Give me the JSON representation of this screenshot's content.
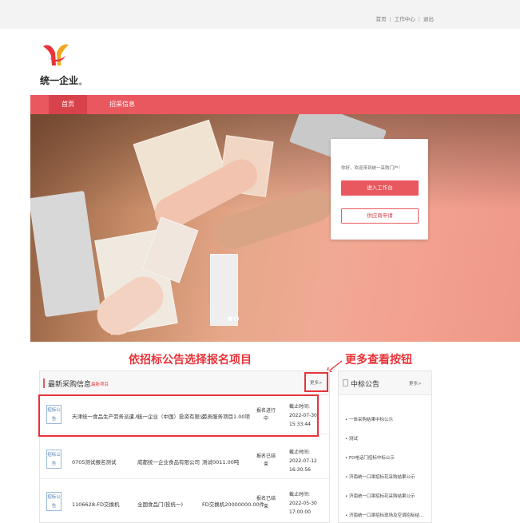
{
  "topbar": {
    "links": [
      "首页",
      "工作中心",
      "退出"
    ],
    "separator": "|"
  },
  "logo": {
    "text": "统一企业",
    "reg": "®"
  },
  "nav": {
    "items": [
      "首页",
      "招采信息"
    ]
  },
  "banner": {
    "login": {
      "welcome": "你好，欢迎来到统一采购门户！",
      "workbench_button": "进入工作台",
      "supplier_button": "供应商申请"
    }
  },
  "annotations": {
    "left": "依招标公告选择报名项目",
    "right": "更多查看按钮"
  },
  "main_panel": {
    "title": "最新采购信息",
    "subtitle": "最新项目",
    "more": "更多>",
    "rows": [
      {
        "badge": "招标公告",
        "name": "天津统一食品生产劳务派遣人...",
        "company": "统一企业（中国）投资有限公...",
        "code": "劳务服务项目1.00项",
        "status": "报名进行中",
        "deadline_label": "截止时间:",
        "deadline_date": "2022-07-30",
        "deadline_time": "15:33:44"
      },
      {
        "badge": "招标公告",
        "name": "0705测试报名测试",
        "company": "成都统一企业食品有限公司",
        "code": "测试0011.00吨",
        "status": "报名已结束",
        "deadline_label": "截止时间:",
        "deadline_date": "2022-07-12",
        "deadline_time": "16:30:56"
      },
      {
        "badge": "招标公告",
        "name": "1106628-FD交换机",
        "company": "全国食品门(投统一)",
        "code": "FD交换机20000000.00件",
        "status": "报名已结束",
        "deadline_label": "截止时间:",
        "deadline_date": "2022-05-30",
        "deadline_time": "17:00:00"
      }
    ]
  },
  "side_panel": {
    "title": "中标公告",
    "more": "更多>",
    "items": [
      "一体采购结果中标公示",
      "测试",
      "FD电话门招标中标公示",
      "济南统一口罩招标花采购结果公示",
      "济南统一口罩招标花采购结果公示",
      "济南统一口罩招标现场及空调招标结..."
    ]
  },
  "colors": {
    "brand_red": "#e9585e",
    "annotation_red": "#e8343a",
    "badge_blue": "#4f7fb5"
  }
}
